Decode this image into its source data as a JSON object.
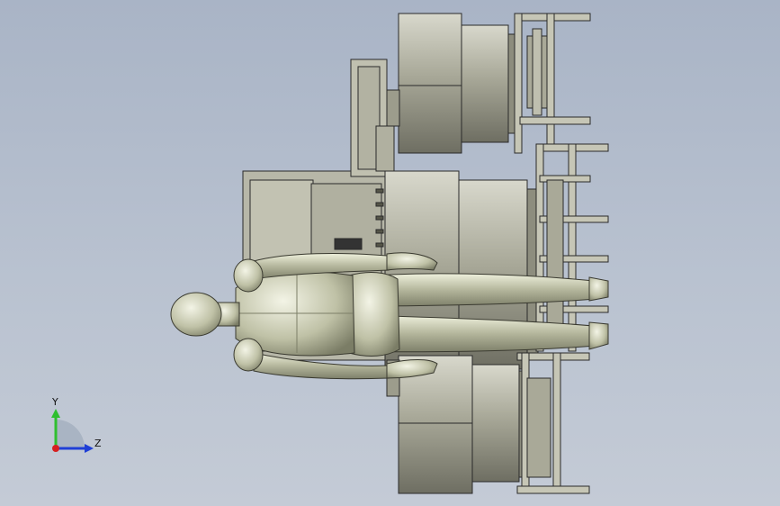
{
  "viewport": {
    "background_top": "#a9b4c6",
    "background_bottom": "#c4cbd6"
  },
  "model": {
    "description_icon": "cad-assembly-icon",
    "part_color": "#b8b8a6",
    "edge_color": "#2a2a2a",
    "figure_color": "#c9cbb2"
  },
  "triad": {
    "y_label": "Y",
    "z_label": "Z",
    "y_color": "#2fbf2f",
    "z_color": "#1f3fd6",
    "origin_color": "#d62020"
  }
}
